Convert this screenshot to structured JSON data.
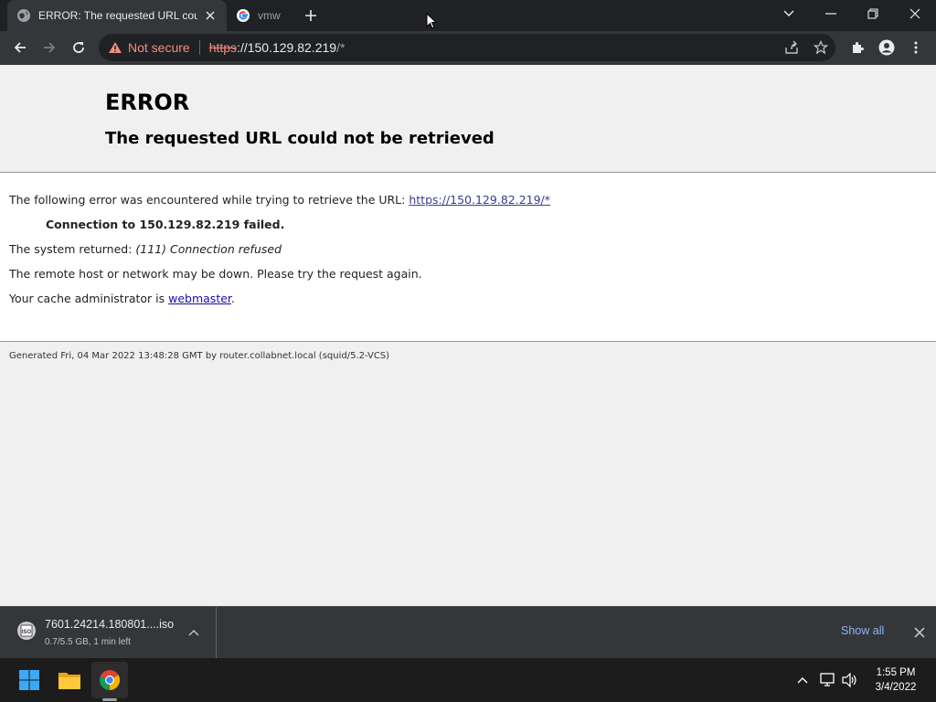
{
  "browser": {
    "tabs": [
      {
        "title": "ERROR: The requested URL could not be retrieved",
        "favicon": "globe-icon",
        "active": true
      },
      {
        "title": "vmw",
        "favicon": "google-icon",
        "active": false
      }
    ],
    "address_bar": {
      "security_label": "Not secure",
      "url_scheme": "https",
      "url_rest": "://150.129.82.219",
      "url_path": "/*"
    }
  },
  "page": {
    "title": "ERROR",
    "subtitle": "The requested URL could not be retrieved",
    "line1_prefix": "The following error was encountered while trying to retrieve the URL: ",
    "line1_link": "https://150.129.82.219/*",
    "line2": "Connection to 150.129.82.219 failed.",
    "line3_prefix": "The system returned: ",
    "line3_italic": "(111) Connection refused",
    "line4": "The remote host or network may be down. Please try the request again.",
    "line5_prefix": "Your cache administrator is ",
    "line5_link": "webmaster",
    "line5_suffix": ".",
    "footer": "Generated Fri, 04 Mar 2022 13:48:28 GMT by router.collabnet.local (squid/5.2-VCS)"
  },
  "download_bar": {
    "file_name": "7601.24214.180801....iso",
    "status": "0.7/5.5 GB, 1 min left",
    "icon_label": "ISO",
    "show_all": "Show all"
  },
  "taskbar": {
    "time": "1:55 PM",
    "date": "3/4/2022"
  },
  "colors": {
    "accent_link": "#8ab4f8",
    "warning": "#f28b82",
    "page_bg": "#f0f0f0"
  }
}
